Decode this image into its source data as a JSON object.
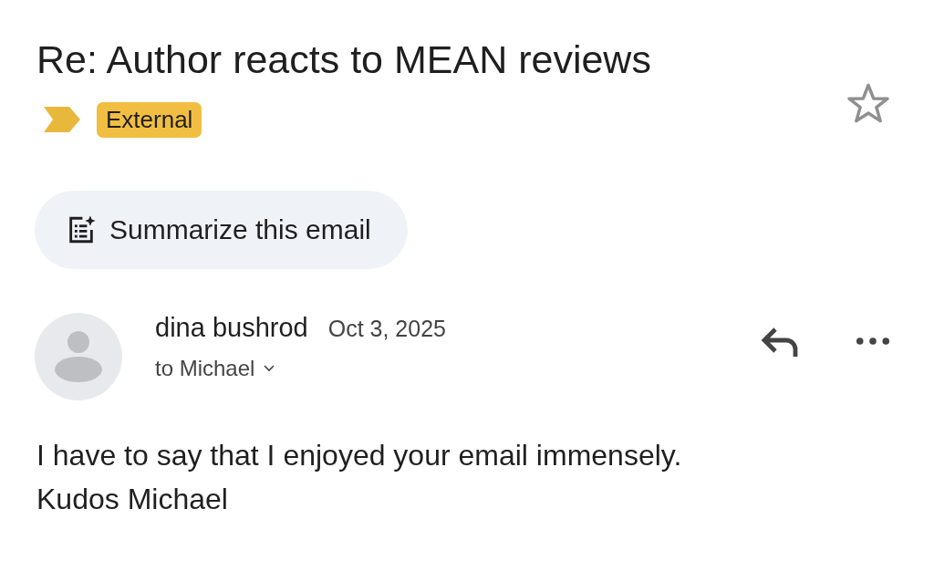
{
  "subject": "Re: Author reacts to MEAN reviews",
  "starred": false,
  "important": true,
  "labels": [
    {
      "text": "External",
      "color": "#f2be42"
    }
  ],
  "summarize_button": {
    "label": "Summarize this email"
  },
  "message": {
    "sender": "dina bushrod",
    "date": "Oct 3, 2025",
    "recipients": "to Michael",
    "body": [
      "I have to say that I enjoyed your email immensely.",
      "Kudos Michael"
    ]
  }
}
